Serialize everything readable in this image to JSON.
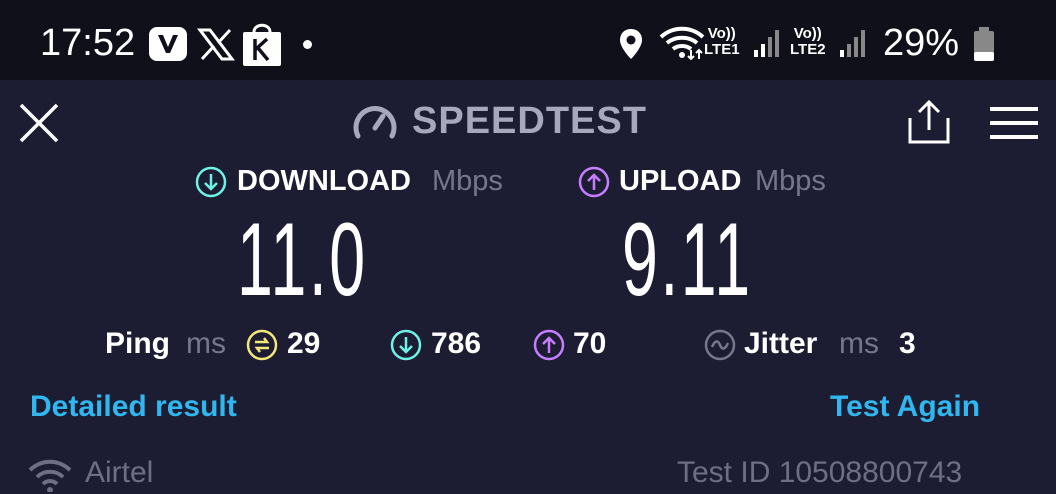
{
  "status_bar": {
    "time": "17:52",
    "app_icons": [
      "vpn-icon",
      "x-icon",
      "kite-bag-icon"
    ],
    "network1": {
      "volte": "Vo))",
      "label": "LTE1"
    },
    "network2": {
      "volte": "Vo))",
      "label": "LTE2"
    },
    "battery": "29%"
  },
  "header": {
    "title": "SPEEDTEST"
  },
  "download": {
    "label": "DOWNLOAD",
    "unit": "Mbps",
    "value": "11.0"
  },
  "upload": {
    "label": "UPLOAD",
    "unit": "Mbps",
    "value": "9.11"
  },
  "ping": {
    "label": "Ping",
    "unit": "ms",
    "idle": "29",
    "download": "786",
    "upload": "70"
  },
  "jitter": {
    "label": "Jitter",
    "unit": "ms",
    "value": "3"
  },
  "actions": {
    "detailed": "Detailed result",
    "again": "Test Again"
  },
  "footer": {
    "provider": "Airtel",
    "test_id": "Test ID 10508800743"
  },
  "colors": {
    "background": "#1c1d33",
    "status_bar": "#0f1019",
    "download_accent": "#6ef2e6",
    "upload_accent": "#c77dff",
    "ping_accent": "#f5e67a",
    "link": "#31b7ef"
  }
}
